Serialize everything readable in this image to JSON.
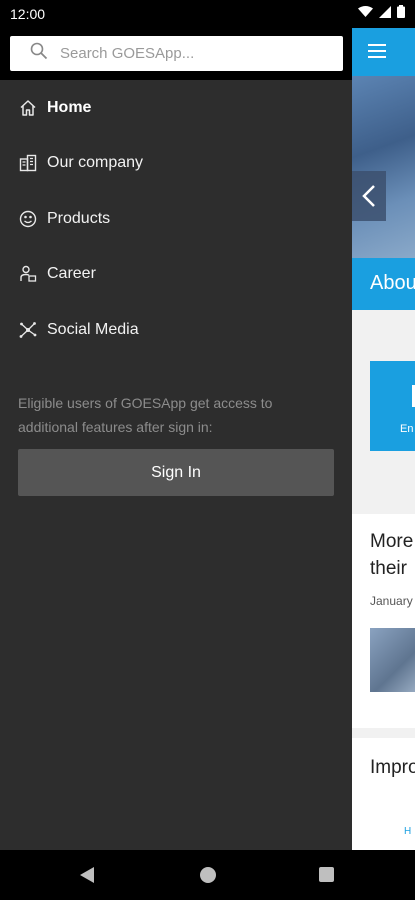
{
  "status": {
    "time": "12:00"
  },
  "search": {
    "placeholder": "Search GOESApp..."
  },
  "nav": {
    "items": [
      {
        "label": "Home",
        "icon": "home-icon",
        "active": true
      },
      {
        "label": "Our company",
        "icon": "building-icon"
      },
      {
        "label": "Products",
        "icon": "products-icon"
      },
      {
        "label": "Career",
        "icon": "career-icon"
      },
      {
        "label": "Social Media",
        "icon": "network-icon"
      }
    ]
  },
  "signin": {
    "note": "Eligible users of GOESApp get access to additional features after sign in:",
    "button_label": "Sign In"
  },
  "underlay": {
    "about_label": "Abou",
    "card_label": "En",
    "news1_title_line1": "More",
    "news1_title_line2": "their",
    "news1_date": "January",
    "news2_title": "Impro",
    "tab_label": "H"
  },
  "colors": {
    "accent": "#1a9fe0",
    "drawer_bg": "#2d2d2d",
    "button_bg": "#555555"
  }
}
